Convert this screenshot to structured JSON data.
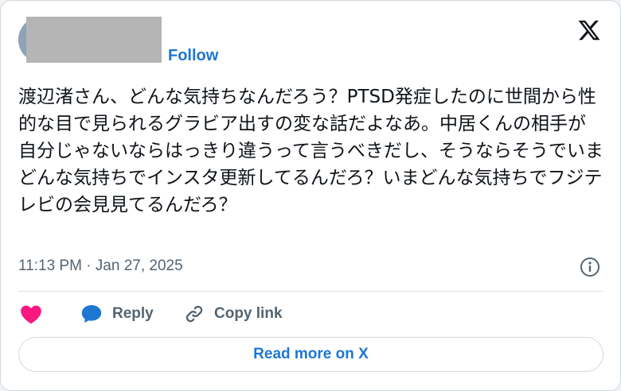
{
  "header": {
    "follow_label": "Follow"
  },
  "tweet": {
    "text": "渡辺渚さん、どんな気持ちなんだろう？PTSD発症したのに世間から性的な目で見られるグラビア出すの変な話だよなあ。中居くんの相手が自分じゃないならはっきり違うって言うべきだし、そうならそうでいまどんな気持ちでインスタ更新してるんだろ？いまどんな気持ちでフジテレビの会見見てるんだろ？",
    "timestamp": "11:13 PM · Jan 27, 2025"
  },
  "actions": {
    "reply_label": "Reply",
    "copy_link_label": "Copy link"
  },
  "footer": {
    "read_more_label": "Read more on X"
  },
  "colors": {
    "accent": "#1d76d2",
    "like": "#f91880",
    "secondary_text": "#536471",
    "border": "#cfd9de"
  },
  "icons": [
    "x-logo-icon",
    "info-icon",
    "heart-icon",
    "reply-bubble-icon",
    "link-icon"
  ]
}
